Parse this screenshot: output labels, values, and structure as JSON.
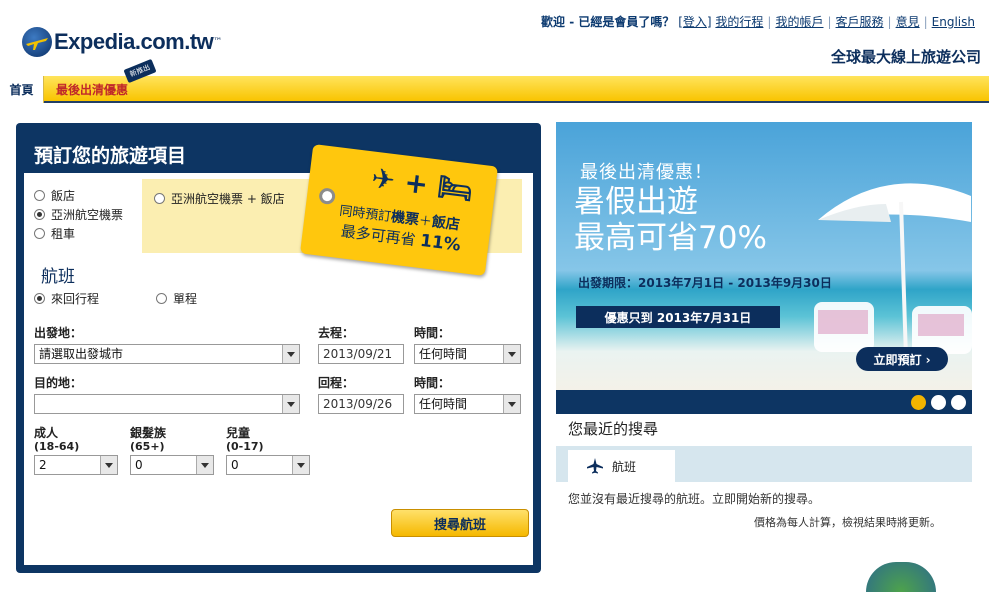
{
  "header": {
    "logo_text": "Expedia.com.tw",
    "logo_tm": "™",
    "welcome": "歡迎 - 已經是會員了嗎？",
    "login_prefix": "[",
    "login": "登入",
    "login_suffix": "]",
    "my_itinerary": "我的行程",
    "my_account": "我的帳戶",
    "customer_service": "客戶服務",
    "feedback": "意見",
    "english": "English",
    "tagline": "全球最大線上旅遊公司"
  },
  "nav": {
    "home": "首頁",
    "last_minute": "最後出清優惠",
    "badge": "新推出"
  },
  "booking": {
    "title": "預訂您的旅遊項目",
    "types": [
      {
        "label": "飯店",
        "checked": false
      },
      {
        "label": "亞洲航空機票",
        "checked": true
      },
      {
        "label": "租車",
        "checked": false
      }
    ],
    "package_option": "亞洲航空機票 + 飯店",
    "tag": {
      "icons": "✈ + 🛏",
      "line1_pre": "同時預訂",
      "line1_bold1": "機票",
      "line1_mid": "＋",
      "line1_bold2": "飯店",
      "line2_pre": "最多可再省 ",
      "line2_bold": "11%"
    },
    "section_title": "航班",
    "trip_types": [
      {
        "label": "來回行程",
        "checked": true
      },
      {
        "label": "單程",
        "checked": false
      }
    ],
    "from_label": "出發地：",
    "from_value": "請選取出發城市",
    "depart_label": "去程：",
    "depart_value": "2013/09/21",
    "depart_time_label": "時間：",
    "depart_time_value": "任何時間",
    "to_label": "目的地：",
    "to_value": "",
    "return_label": "回程：",
    "return_value": "2013/09/26",
    "return_time_label": "時間：",
    "return_time_value": "任何時間",
    "adults_label": "成人",
    "adults_sub": "(18-64)",
    "adults_value": "2",
    "seniors_label": "銀髮族",
    "seniors_sub": "(65+)",
    "seniors_value": "0",
    "children_label": "兒童",
    "children_sub": "(0-17)",
    "children_value": "0",
    "search_button": "搜尋航班"
  },
  "banner": {
    "line1": "最後出清優惠！",
    "line2": "暑假出遊",
    "line3": "最高可省70%",
    "period": "出發期限：2013年7月1日 - 2013年9月30日",
    "deadline": "優惠只到 2013年7月31日",
    "cta": "立即預訂 ›",
    "slides_active": 0
  },
  "recent": {
    "title": "您最近的搜尋",
    "tab": "航班",
    "message": "您並沒有最近搜尋的航班。立即開始新的搜尋。",
    "note": "價格為每人計算，檢視結果時將更新。"
  }
}
